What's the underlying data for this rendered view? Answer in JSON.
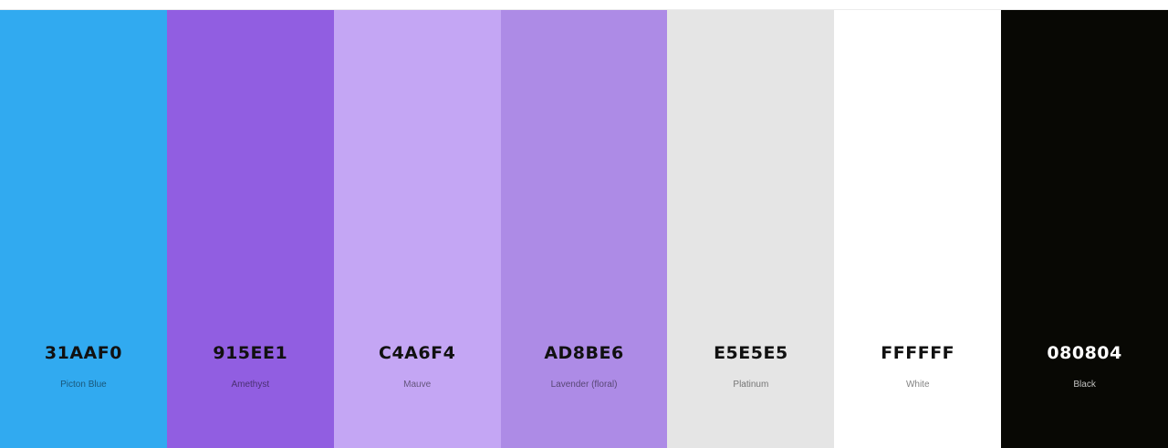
{
  "palette": {
    "swatches": [
      {
        "hex": "31AAF0",
        "name": "Picton Blue",
        "color": "#31AAF0",
        "text_color": "#111111",
        "name_color": "rgba(0,0,0,0.5)"
      },
      {
        "hex": "915EE1",
        "name": "Amethyst",
        "color": "#915EE1",
        "text_color": "#111111",
        "name_color": "rgba(0,0,0,0.5)"
      },
      {
        "hex": "C4A6F4",
        "name": "Mauve",
        "color": "#C4A6F4",
        "text_color": "#111111",
        "name_color": "rgba(0,0,0,0.5)"
      },
      {
        "hex": "AD8BE6",
        "name": "Lavender (floral)",
        "color": "#AD8BE6",
        "text_color": "#111111",
        "name_color": "rgba(0,0,0,0.5)"
      },
      {
        "hex": "E5E5E5",
        "name": "Platinum",
        "color": "#E5E5E5",
        "text_color": "#111111",
        "name_color": "rgba(0,0,0,0.5)"
      },
      {
        "hex": "FFFFFF",
        "name": "White",
        "color": "#FFFFFF",
        "text_color": "#111111",
        "name_color": "rgba(0,0,0,0.5)"
      },
      {
        "hex": "080804",
        "name": "Black",
        "color": "#080804",
        "text_color": "#FFFFFF",
        "name_color": "rgba(255,255,255,0.75)"
      }
    ]
  }
}
